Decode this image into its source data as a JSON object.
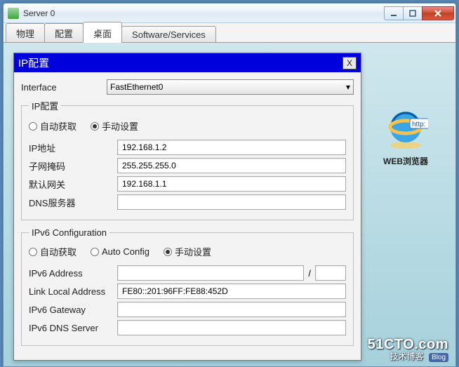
{
  "window": {
    "title": "Server 0"
  },
  "tabs": {
    "t0": "物理",
    "t1": "配置",
    "t2": "桌面",
    "t3": "Software/Services"
  },
  "dialog": {
    "title": "IP配置",
    "close": "X",
    "interface_label": "Interface",
    "interface_value": "FastEthernet0"
  },
  "ipv4": {
    "legend": "IP配置",
    "radio_dhcp": "自动获取",
    "radio_static": "手动设置",
    "ip_label": "IP地址",
    "ip_value": "192.168.1.2",
    "mask_label": "子网掩码",
    "mask_value": "255.255.255.0",
    "gw_label": "默认网关",
    "gw_value": "192.168.1.1",
    "dns_label": "DNS服务器",
    "dns_value": ""
  },
  "ipv6": {
    "legend": "IPv6 Configuration",
    "radio_dhcp": "自动获取",
    "radio_autoconf": "Auto Config",
    "radio_static": "手动设置",
    "addr_label": "IPv6 Address",
    "addr_value": "",
    "prefix_value": "",
    "ll_label": "Link Local Address",
    "ll_value": "FE80::201:96FF:FE88:452D",
    "gw_label": "IPv6 Gateway",
    "gw_value": "",
    "dns_label": "IPv6 DNS Server",
    "dns_value": ""
  },
  "desktop": {
    "web_label": "WEB浏览器",
    "http_badge": "http:"
  },
  "watermark": {
    "line1": "51CTO.com",
    "line2": "技术博客",
    "blog": "Blog"
  }
}
